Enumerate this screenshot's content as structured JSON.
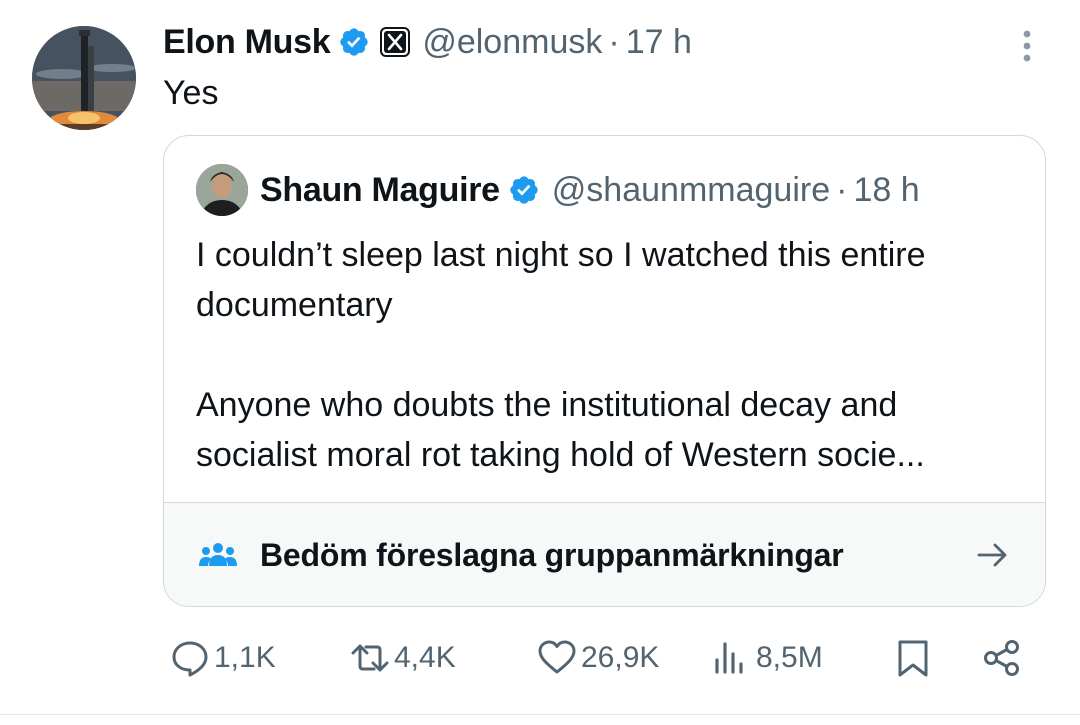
{
  "post": {
    "author_name": "Elon Musk",
    "handle": "@elonmusk",
    "separator": "·",
    "time": "17 h",
    "text": "Yes"
  },
  "quoted": {
    "author_name": "Shaun Maguire",
    "handle": "@shaunmmaguire",
    "separator": "·",
    "time": "18 h",
    "paragraphs": [
      "I couldn’t sleep last night so I watched this entire documentary",
      "Anyone who doubts the institutional decay and socialist moral rot taking hold of Western socie..."
    ],
    "note_label": "Bedöm föreslagna gruppanmärkningar"
  },
  "actions": {
    "replies": "1,1K",
    "reposts": "4,4K",
    "likes": "26,9K",
    "views": "8,5M"
  },
  "icons": {
    "verified": "verified-badge-icon",
    "affiliate": "x-logo-icon",
    "more": "more-vertical-icon",
    "community_notes": "people-icon",
    "arrow": "arrow-right-icon",
    "reply": "reply-icon",
    "repost": "repost-icon",
    "like": "heart-icon",
    "views": "views-icon",
    "bookmark": "bookmark-icon",
    "share": "share-icon"
  },
  "colors": {
    "text": "#0f1419",
    "secondary": "#536471",
    "verified": "#1d9bf0",
    "community_notes": "#1d9bf0",
    "border": "#cfd9de"
  }
}
